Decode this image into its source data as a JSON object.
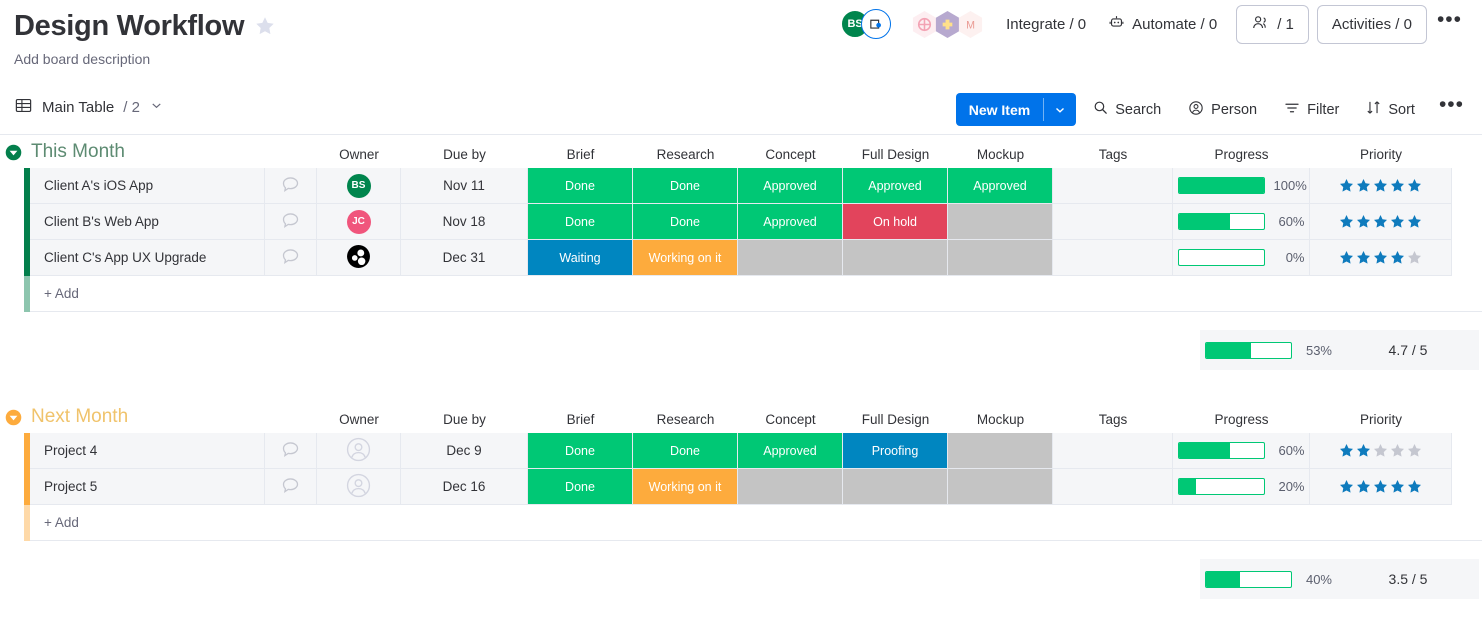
{
  "header": {
    "title": "Design Workflow",
    "description": "Add board description",
    "avatars": [
      {
        "initials": "BS",
        "color": "#00854d"
      }
    ],
    "integrate_label": "Integrate / 0",
    "automate_label": "Automate / 0",
    "people_label": "/ 1",
    "activities_label": "Activities / 0",
    "more_label": "•••"
  },
  "toolbar": {
    "view_label": "Main Table",
    "view_count": "/ 2",
    "new_item_label": "New Item",
    "search_label": "Search",
    "person_label": "Person",
    "filter_label": "Filter",
    "sort_label": "Sort",
    "more_label": "•••"
  },
  "columns": [
    "Owner",
    "Due by",
    "Brief",
    "Research",
    "Concept",
    "Full Design",
    "Mockup",
    "Tags",
    "Progress",
    "Priority"
  ],
  "colors": {
    "green": "#00c875",
    "red": "#e2445c",
    "orange": "#fdab3d",
    "blue": "#0086c0",
    "grey": "#c4c4c4",
    "group_green": "#037f4c",
    "group_yellow": "#fdab3d",
    "accent_blue": "#0073ea",
    "star_blue": "#0f7bbd",
    "star_grey": "#c5c7d0"
  },
  "groups": [
    {
      "name": "This Month",
      "color": "#037f4c",
      "caret_color": "#037f4c",
      "title_color": "#5d8b72",
      "add_label": "+ Add",
      "rows": [
        {
          "name": "Client A's iOS App",
          "owner": {
            "initials": "BS",
            "color": "#00854d",
            "type": "initials"
          },
          "date": "Nov 11",
          "statuses": [
            {
              "label": "Done",
              "color": "#00c875"
            },
            {
              "label": "Done",
              "color": "#00c875"
            },
            {
              "label": "Approved",
              "color": "#00c875"
            },
            {
              "label": "Approved",
              "color": "#00c875"
            },
            {
              "label": "Approved",
              "color": "#00c875"
            }
          ],
          "tags": "",
          "progress": 100,
          "progress_label": "100%",
          "priority": 5
        },
        {
          "name": "Client B's Web App",
          "owner": {
            "initials": "JC",
            "color": "#f0557c",
            "type": "initials"
          },
          "date": "Nov 18",
          "statuses": [
            {
              "label": "Done",
              "color": "#00c875"
            },
            {
              "label": "Done",
              "color": "#00c875"
            },
            {
              "label": "Approved",
              "color": "#00c875"
            },
            {
              "label": "On hold",
              "color": "#e2445c"
            },
            {
              "label": "",
              "color": "#c4c4c4"
            }
          ],
          "tags": "",
          "progress": 60,
          "progress_label": "60%",
          "priority": 5
        },
        {
          "name": "Client C's App UX Upgrade",
          "owner": {
            "initials": "",
            "color": "#000000",
            "type": "team"
          },
          "date": "Dec 31",
          "statuses": [
            {
              "label": "Waiting",
              "color": "#0086c0"
            },
            {
              "label": "Working on it",
              "color": "#fdab3d"
            },
            {
              "label": "",
              "color": "#c4c4c4"
            },
            {
              "label": "",
              "color": "#c4c4c4"
            },
            {
              "label": "",
              "color": "#c4c4c4"
            }
          ],
          "tags": "",
          "progress": 0,
          "progress_label": "0%",
          "priority": 4
        }
      ],
      "summary": {
        "progress": 53,
        "progress_label": "53%",
        "priority_label": "4.7 / 5"
      }
    },
    {
      "name": "Next Month",
      "color": "#fdab3d",
      "caret_color": "#fdab3d",
      "title_color": "#f0c36b",
      "add_label": "+ Add",
      "rows": [
        {
          "name": "Project 4",
          "owner": {
            "initials": "",
            "color": "#c5c7d0",
            "type": "empty"
          },
          "date": "Dec 9",
          "statuses": [
            {
              "label": "Done",
              "color": "#00c875"
            },
            {
              "label": "Done",
              "color": "#00c875"
            },
            {
              "label": "Approved",
              "color": "#00c875"
            },
            {
              "label": "Proofing",
              "color": "#0086c0"
            },
            {
              "label": "",
              "color": "#c4c4c4"
            }
          ],
          "tags": "",
          "progress": 60,
          "progress_label": "60%",
          "priority": 2
        },
        {
          "name": "Project 5",
          "owner": {
            "initials": "",
            "color": "#c5c7d0",
            "type": "empty"
          },
          "date": "Dec 16",
          "statuses": [
            {
              "label": "Done",
              "color": "#00c875"
            },
            {
              "label": "Working on it",
              "color": "#fdab3d"
            },
            {
              "label": "",
              "color": "#c4c4c4"
            },
            {
              "label": "",
              "color": "#c4c4c4"
            },
            {
              "label": "",
              "color": "#c4c4c4"
            }
          ],
          "tags": "",
          "progress": 20,
          "progress_label": "20%",
          "priority": 5
        }
      ],
      "summary": {
        "progress": 40,
        "progress_label": "40%",
        "priority_label": "3.5 / 5"
      }
    }
  ]
}
